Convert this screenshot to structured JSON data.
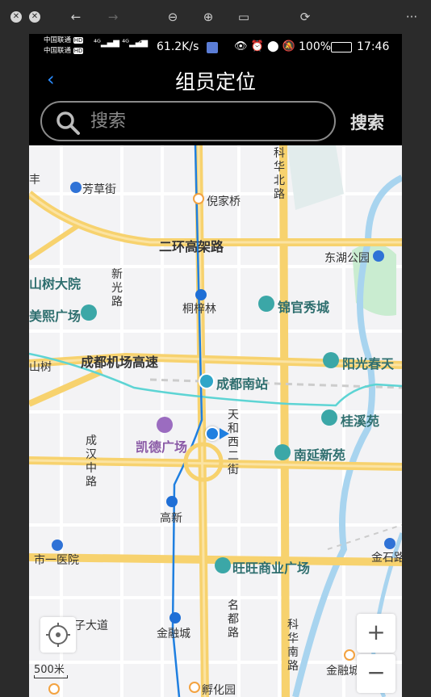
{
  "viewer": {
    "buttons": [
      "close",
      "close-all",
      "back",
      "forward",
      "zoom-out",
      "zoom-in",
      "fit",
      "rotate",
      "more"
    ]
  },
  "status_bar": {
    "carrier1": "中国联通",
    "carrier2": "中国联通",
    "network": "4G",
    "speed": "61.2K/s",
    "battery": "100%",
    "time": "17:46"
  },
  "header": {
    "back_label": "‹",
    "title": "组员定位"
  },
  "search": {
    "placeholder": "搜索",
    "button_label": "搜索"
  },
  "map": {
    "labels": {
      "fangcaojie": "芳草街",
      "nijiaqiao": "倪家桥",
      "kehuabeilu": "科华北路",
      "erhuan": "二环高架路",
      "donghu": "东湖公园",
      "shushu": "山树大院",
      "xinguanglu": "新光路",
      "tongzilin": "桐梓林",
      "jinguan": "锦官秀城",
      "meixi": "美熙广场",
      "shanshu": "山树",
      "jichang": "成都机场高速",
      "yangguang": "阳光春天",
      "nanzhan": "成都南站",
      "guixi": "桂溪苑",
      "tianhe": "天和西二街",
      "kaide": "凯德广场",
      "chenghan": "成汉中路",
      "nanyan": "南延新苑",
      "feng": "丰",
      "gaoxin": "高新",
      "yiyuan": "市一医院",
      "jinshi": "金石路",
      "wangwang": "旺旺商业广场",
      "zidajie": "子大道",
      "jinrongcheng": "金融城",
      "mingdu": "名都路",
      "kehuanan": "科华南路",
      "jinrong2": "金融城",
      "fuhua": "孵化园",
      "scale": "500米"
    },
    "zoom_in": "+",
    "zoom_out": "−"
  }
}
